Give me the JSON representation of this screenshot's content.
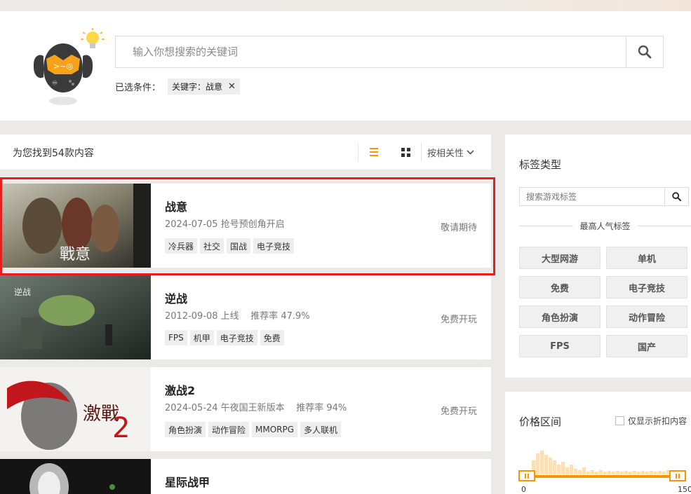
{
  "search": {
    "placeholder": "输入你想搜索的关键词",
    "filter_label": "已选条件：",
    "chips": [
      "关键字：战意"
    ]
  },
  "results": {
    "count_text": "为您找到54款内容",
    "sort_label": "按相关性"
  },
  "games": [
    {
      "name": "战意",
      "meta": "2024-07-05 抢号预创角开启",
      "tags": [
        "冷兵器",
        "社交",
        "国战",
        "电子竞技"
      ],
      "status": "敬请期待"
    },
    {
      "name": "逆战",
      "meta": "2012-09-08 上线    推荐率 47.9%",
      "tags": [
        "FPS",
        "机甲",
        "电子竞技",
        "免费"
      ],
      "status": "免费开玩"
    },
    {
      "name": "激战2",
      "meta": "2024-05-24 午夜国王新版本    推荐率 94%",
      "tags": [
        "角色扮演",
        "动作冒险",
        "MMORPG",
        "多人联机"
      ],
      "status": "免费开玩"
    },
    {
      "name": "星际战甲",
      "meta": "",
      "tags": [],
      "status": ""
    }
  ],
  "sidebar": {
    "tag_title": "标签类型",
    "tag_search_placeholder": "搜索游戏标签",
    "popular_label": "最高人气标签",
    "tags": [
      "大型网游",
      "单机",
      "免费",
      "电子竞技",
      "角色扮演",
      "动作冒险",
      "FPS",
      "国产"
    ],
    "price_title": "价格区间",
    "discount_label": "仅显示折扣内容",
    "price_min": "0",
    "price_max": "150"
  },
  "colors": {
    "accent": "#f39800",
    "highlight": "#e61e1e"
  }
}
